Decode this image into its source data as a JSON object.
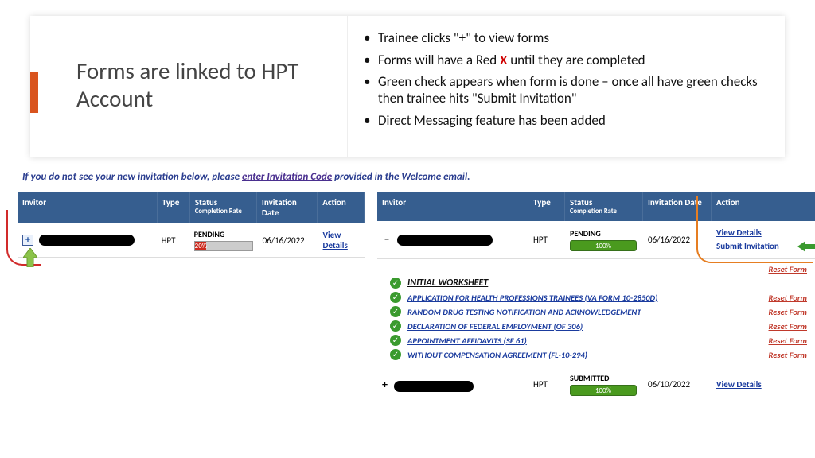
{
  "title": "Forms are linked to HPT Account",
  "bullets": [
    {
      "pre": "Trainee clicks \"+\" to view forms"
    },
    {
      "pre": "Forms will have a Red ",
      "x": "X",
      "post": " until they are completed"
    },
    {
      "pre": "Green check appears when form is done – once all have green checks then trainee hits \"Submit Invitation\""
    },
    {
      "pre": "Direct Messaging feature has been added"
    }
  ],
  "helper": {
    "pre": "If you do not see your new invitation below, please ",
    "link": "enter Invitation Code",
    "post": " provided in the Welcome email."
  },
  "headers": {
    "invitor": "Invitor",
    "type": "Type",
    "status": "Status",
    "completion": "Completion Rate",
    "invitation_date": "Invitation Date",
    "action": "Action"
  },
  "left": {
    "type": "HPT",
    "status": "PENDING",
    "progress": "20%",
    "date": "06/16/2022",
    "action": "View Details"
  },
  "right": {
    "row1": {
      "type": "HPT",
      "status": "PENDING",
      "progress": "100%",
      "date": "06/16/2022",
      "view": "View Details",
      "submit": "Submit Invitation"
    },
    "forms": [
      {
        "name": "INITIAL WORKSHEET",
        "first": true
      },
      {
        "name": "APPLICATION FOR HEALTH PROFESSIONS TRAINEES (VA FORM 10-2850D)",
        "reset": "Reset Form"
      },
      {
        "name": "RANDOM DRUG TESTING NOTIFICATION AND ACKNOWLEDGEMENT",
        "reset": "Reset Form"
      },
      {
        "name": "DECLARATION OF FEDERAL EMPLOYMENT (OF 306)",
        "reset": "Reset Form"
      },
      {
        "name": "APPOINTMENT AFFIDAVITS (SF 61)",
        "reset": "Reset Form"
      },
      {
        "name": "WITHOUT COMPENSATION AGREEMENT (FL-10-294)",
        "reset": "Reset Form"
      }
    ],
    "forms_reset_header": "Reset Form",
    "row2": {
      "type": "HPT",
      "status": "SUBMITTED",
      "progress": "100%",
      "date": "06/10/2022",
      "action": "View Details"
    }
  }
}
